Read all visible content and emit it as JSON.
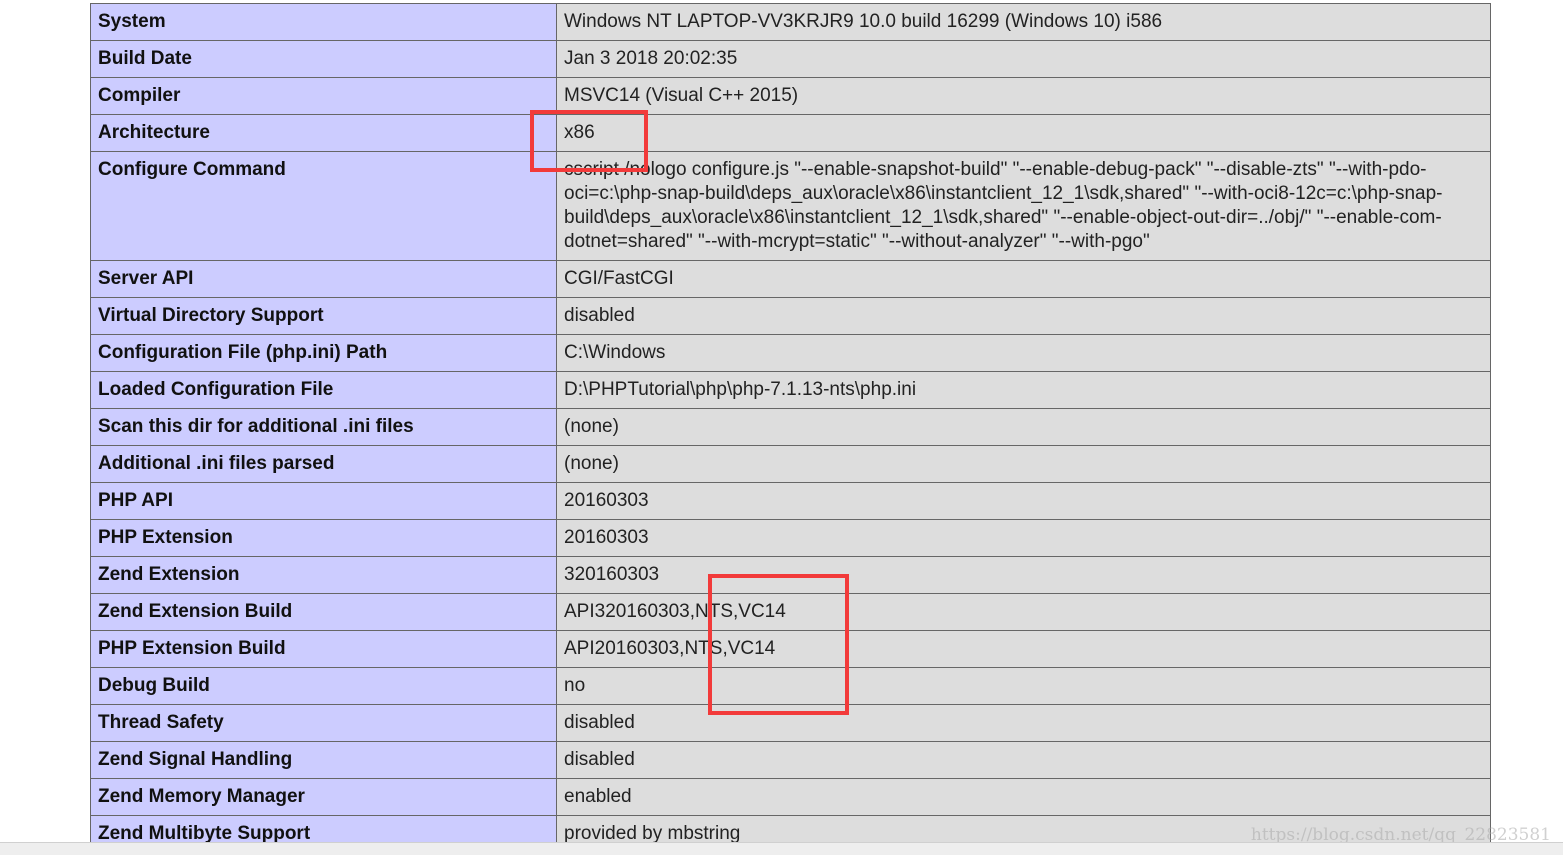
{
  "rows": [
    {
      "key": "System",
      "value": "Windows NT LAPTOP-VV3KRJR9 10.0 build 16299 (Windows 10) i586"
    },
    {
      "key": "Build Date",
      "value": "Jan 3 2018 20:02:35"
    },
    {
      "key": "Compiler",
      "value": "MSVC14 (Visual C++ 2015)"
    },
    {
      "key": "Architecture",
      "value": "x86"
    },
    {
      "key": "Configure Command",
      "value": "cscript /nologo configure.js \"--enable-snapshot-build\" \"--enable-debug-pack\" \"--disable-zts\" \"--with-pdo-oci=c:\\php-snap-build\\deps_aux\\oracle\\x86\\instantclient_12_1\\sdk,shared\" \"--with-oci8-12c=c:\\php-snap-build\\deps_aux\\oracle\\x86\\instantclient_12_1\\sdk,shared\" \"--enable-object-out-dir=../obj/\" \"--enable-com-dotnet=shared\" \"--with-mcrypt=static\" \"--without-analyzer\" \"--with-pgo\""
    },
    {
      "key": "Server API",
      "value": "CGI/FastCGI"
    },
    {
      "key": "Virtual Directory Support",
      "value": "disabled"
    },
    {
      "key": "Configuration File (php.ini) Path",
      "value": "C:\\Windows"
    },
    {
      "key": "Loaded Configuration File",
      "value": "D:\\PHPTutorial\\php\\php-7.1.13-nts\\php.ini"
    },
    {
      "key": "Scan this dir for additional .ini files",
      "value": "(none)"
    },
    {
      "key": "Additional .ini files parsed",
      "value": "(none)"
    },
    {
      "key": "PHP API",
      "value": "20160303"
    },
    {
      "key": "PHP Extension",
      "value": "20160303"
    },
    {
      "key": "Zend Extension",
      "value": "320160303"
    },
    {
      "key": "Zend Extension Build",
      "value": "API320160303,NTS,VC14"
    },
    {
      "key": "PHP Extension Build",
      "value": "API20160303,NTS,VC14"
    },
    {
      "key": "Debug Build",
      "value": "no"
    },
    {
      "key": "Thread Safety",
      "value": "disabled"
    },
    {
      "key": "Zend Signal Handling",
      "value": "disabled"
    },
    {
      "key": "Zend Memory Manager",
      "value": "enabled"
    },
    {
      "key": "Zend Multibyte Support",
      "value": "provided by mbstring"
    }
  ],
  "watermark": "https://blog.csdn.net/qq_22823581",
  "colors": {
    "key_cell_bg": "#ccccff",
    "value_cell_bg": "#dddddd",
    "border": "#666666",
    "highlight": "#f23a3a"
  }
}
